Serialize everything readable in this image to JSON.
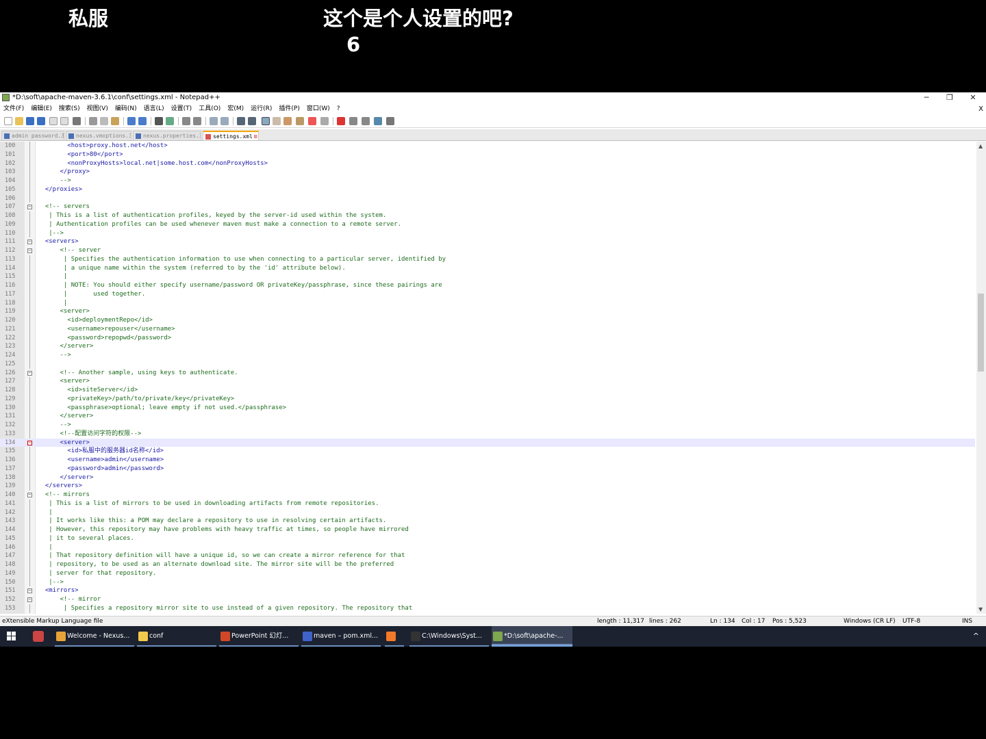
{
  "captions": {
    "left": "私服",
    "middle": "这个是个人设置的吧?",
    "number": "6"
  },
  "window": {
    "title": "*D:\\soft\\apache-maven-3.6.1\\conf\\settings.xml - Notepad++",
    "min": "─",
    "max": "❐",
    "close": "✕",
    "menu_close": "X"
  },
  "menu": [
    "文件(F)",
    "编辑(E)",
    "搜索(S)",
    "视图(V)",
    "编码(N)",
    "语言(L)",
    "设置(T)",
    "工具(O)",
    "宏(M)",
    "运行(R)",
    "插件(P)",
    "窗口(W)",
    "?"
  ],
  "tabs": [
    {
      "label": "admin password.3",
      "active": false
    },
    {
      "label": "nexus.vmoptions.3",
      "active": false
    },
    {
      "label": "nexus.properties.3",
      "active": false
    },
    {
      "label": "settings.xml",
      "active": true
    }
  ],
  "tab_close": "⊠",
  "editor": {
    "lines": [
      {
        "n": "100",
        "t": "        <host>proxy.host.net</host>",
        "k": "tag"
      },
      {
        "n": "101",
        "t": "        <port>80</port>",
        "k": "tag"
      },
      {
        "n": "102",
        "t": "        <nonProxyHosts>local.net|some.host.com</nonProxyHosts>",
        "k": "tag"
      },
      {
        "n": "103",
        "t": "      </proxy>",
        "k": "tag"
      },
      {
        "n": "104",
        "t": "      -->",
        "k": "comment"
      },
      {
        "n": "105",
        "t": "  </proxies>",
        "k": "tag"
      },
      {
        "n": "106",
        "t": "",
        "k": "text"
      },
      {
        "n": "107",
        "t": "  <!-- servers",
        "k": "comment"
      },
      {
        "n": "108",
        "t": "   | This is a list of authentication profiles, keyed by the server-id used within the system.",
        "k": "comment"
      },
      {
        "n": "109",
        "t": "   | Authentication profiles can be used whenever maven must make a connection to a remote server.",
        "k": "comment"
      },
      {
        "n": "110",
        "t": "   |-->",
        "k": "comment"
      },
      {
        "n": "111",
        "t": "  <servers>",
        "k": "tag"
      },
      {
        "n": "112",
        "t": "      <!-- server",
        "k": "comment"
      },
      {
        "n": "113",
        "t": "       | Specifies the authentication information to use when connecting to a particular server, identified by",
        "k": "comment"
      },
      {
        "n": "114",
        "t": "       | a unique name within the system (referred to by the 'id' attribute below).",
        "k": "comment"
      },
      {
        "n": "115",
        "t": "       |",
        "k": "comment"
      },
      {
        "n": "116",
        "t": "       | NOTE: You should either specify username/password OR privateKey/passphrase, since these pairings are",
        "k": "comment"
      },
      {
        "n": "117",
        "t": "       |       used together.",
        "k": "comment"
      },
      {
        "n": "118",
        "t": "       |",
        "k": "comment"
      },
      {
        "n": "119",
        "t": "      <server>",
        "k": "comment"
      },
      {
        "n": "120",
        "t": "        <id>deploymentRepo</id>",
        "k": "comment"
      },
      {
        "n": "121",
        "t": "        <username>repouser</username>",
        "k": "comment"
      },
      {
        "n": "122",
        "t": "        <password>repopwd</password>",
        "k": "comment"
      },
      {
        "n": "123",
        "t": "      </server>",
        "k": "comment"
      },
      {
        "n": "124",
        "t": "      -->",
        "k": "comment"
      },
      {
        "n": "125",
        "t": "",
        "k": "text"
      },
      {
        "n": "126",
        "t": "      <!-- Another sample, using keys to authenticate.",
        "k": "comment"
      },
      {
        "n": "127",
        "t": "      <server>",
        "k": "comment"
      },
      {
        "n": "128",
        "t": "        <id>siteServer</id>",
        "k": "comment"
      },
      {
        "n": "129",
        "t": "        <privateKey>/path/to/private/key</privateKey>",
        "k": "comment"
      },
      {
        "n": "130",
        "t": "        <passphrase>optional; leave empty if not used.</passphrase>",
        "k": "comment"
      },
      {
        "n": "131",
        "t": "      </server>",
        "k": "comment"
      },
      {
        "n": "132",
        "t": "      -->",
        "k": "comment"
      },
      {
        "n": "133",
        "t": "      <!--配置访问字符的权限-->",
        "k": "comment"
      },
      {
        "n": "134",
        "t": "      <server>",
        "k": "tag"
      },
      {
        "n": "135",
        "t": "        <id>私服中的服务器id名称</id>",
        "k": "tag"
      },
      {
        "n": "136",
        "t": "        <username>admin</username>",
        "k": "tag"
      },
      {
        "n": "137",
        "t": "        <password>admin</password>",
        "k": "tag"
      },
      {
        "n": "138",
        "t": "      </server>",
        "k": "tag"
      },
      {
        "n": "139",
        "t": "  </servers>",
        "k": "tag"
      },
      {
        "n": "140",
        "t": "  <!-- mirrors",
        "k": "comment"
      },
      {
        "n": "141",
        "t": "   | This is a list of mirrors to be used in downloading artifacts from remote repositories.",
        "k": "comment"
      },
      {
        "n": "142",
        "t": "   |",
        "k": "comment"
      },
      {
        "n": "143",
        "t": "   | It works like this: a POM may declare a repository to use in resolving certain artifacts.",
        "k": "comment"
      },
      {
        "n": "144",
        "t": "   | However, this repository may have problems with heavy traffic at times, so people have mirrored",
        "k": "comment"
      },
      {
        "n": "145",
        "t": "   | it to several places.",
        "k": "comment"
      },
      {
        "n": "146",
        "t": "   |",
        "k": "comment"
      },
      {
        "n": "147",
        "t": "   | That repository definition will have a unique id, so we can create a mirror reference for that",
        "k": "comment"
      },
      {
        "n": "148",
        "t": "   | repository, to be used as an alternate download site. The mirror site will be the preferred",
        "k": "comment"
      },
      {
        "n": "149",
        "t": "   | server for that repository.",
        "k": "comment"
      },
      {
        "n": "150",
        "t": "   |-->",
        "k": "comment"
      },
      {
        "n": "151",
        "t": "  <mirrors>",
        "k": "tag"
      },
      {
        "n": "152",
        "t": "      <!-- mirror",
        "k": "comment"
      },
      {
        "n": "153",
        "t": "       | Specifies a repository mirror site to use instead of a given repository. The repository that",
        "k": "comment"
      }
    ],
    "current_line": "134"
  },
  "status": {
    "lang": "eXtensible Markup Language file",
    "length": "length : 11,317",
    "lines": "lines : 262",
    "ln": "Ln : 134",
    "col": "Col : 17",
    "pos": "Pos : 5,523",
    "eol": "Windows (CR LF)",
    "enc": "UTF-8",
    "ins": "INS"
  },
  "taskbar": {
    "items": [
      {
        "label": "Welcome - Nexus...",
        "icon": "chrome-icon",
        "color": "#e8a33a"
      },
      {
        "label": "conf",
        "icon": "folder-icon",
        "color": "#f2c94c"
      },
      {
        "label": "PowerPoint 幻灯...",
        "icon": "powerpoint-icon",
        "color": "#d24726"
      },
      {
        "label": "maven – pom.xml...",
        "icon": "intellij-icon",
        "color": "#3f63c9"
      },
      {
        "label": "",
        "icon": "app-icon",
        "color": "#f07a2a"
      },
      {
        "label": "C:\\Windows\\Syst...",
        "icon": "cmd-icon",
        "color": "#333333"
      },
      {
        "label": "*D:\\soft\\apache-...",
        "icon": "notepadpp-icon",
        "color": "#7fa74e"
      }
    ],
    "tray_arrow": "^"
  }
}
